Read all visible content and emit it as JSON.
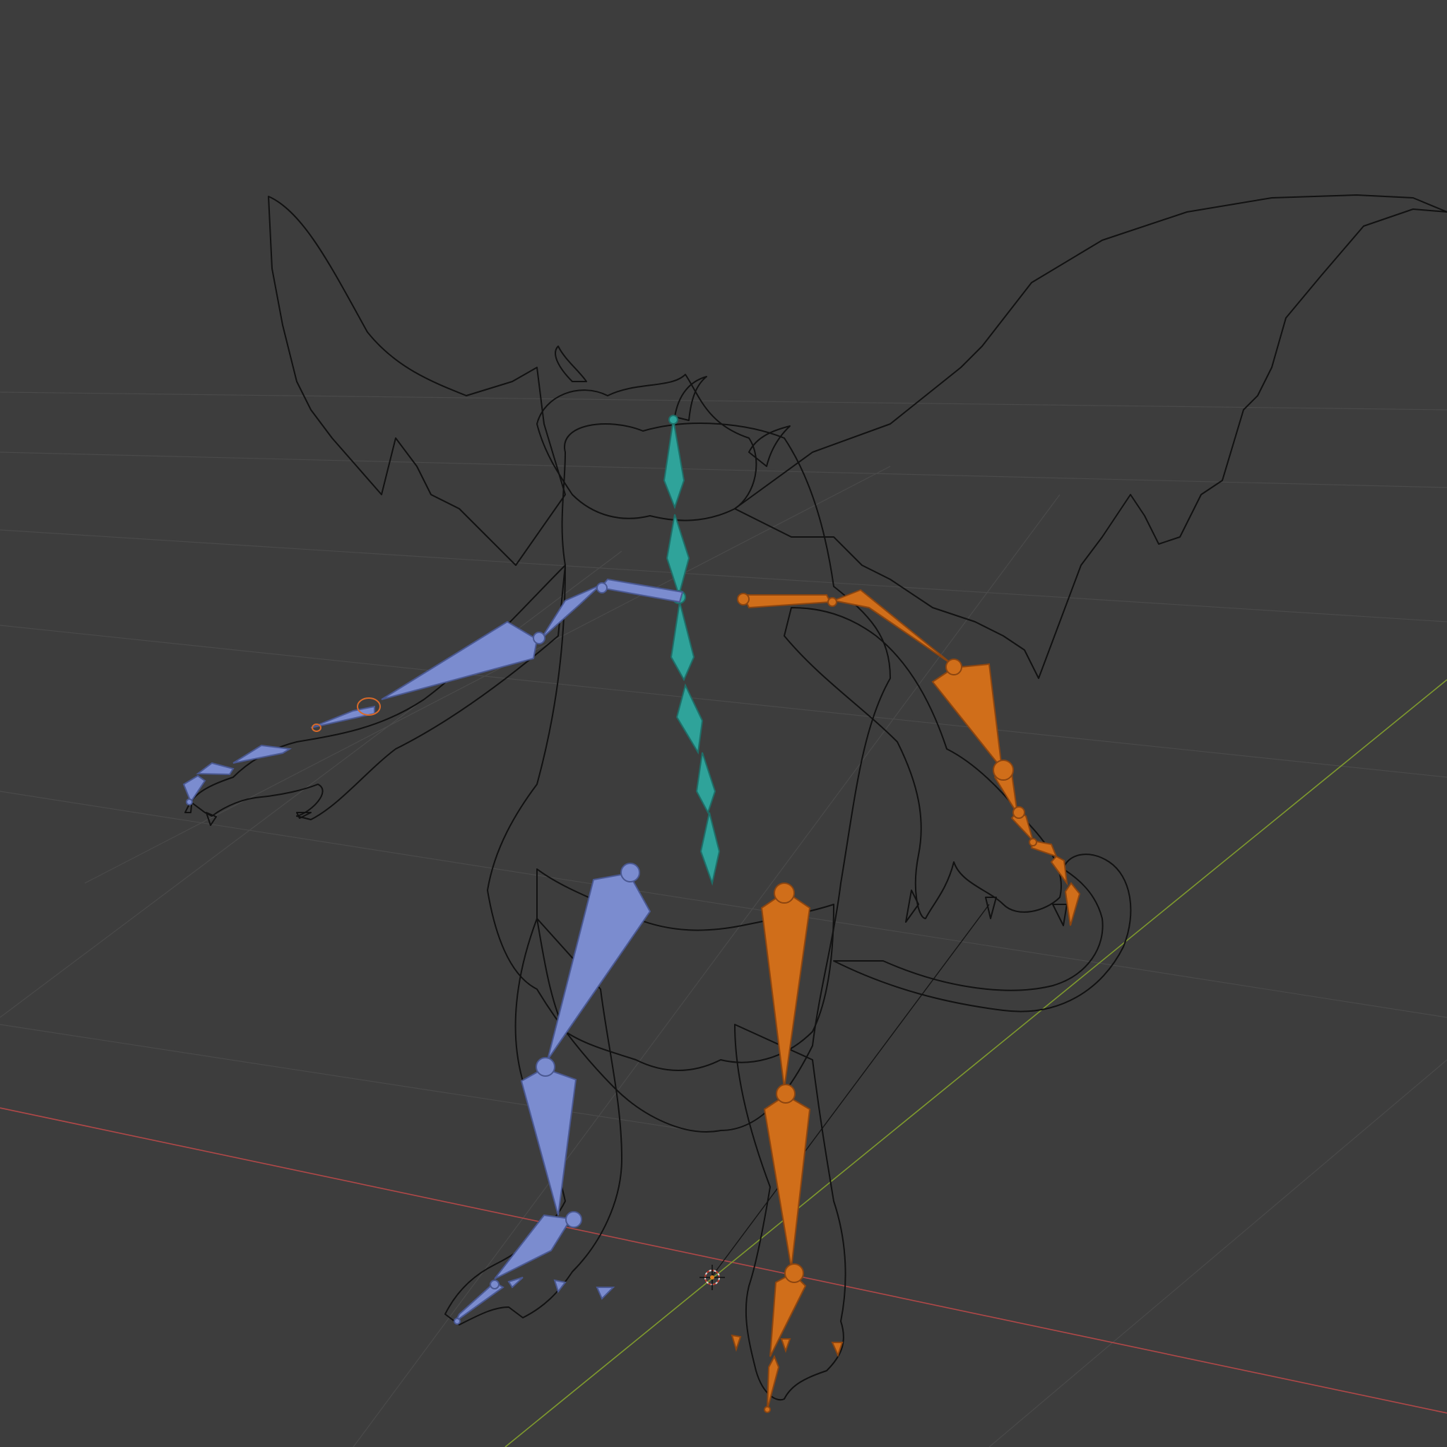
{
  "viewport": {
    "background": "#3d3d3d",
    "grid_color": "#4a4a4a",
    "x_axis_color": "#b04848",
    "y_axis_color": "#7f9a2e",
    "wireframe_color": "#111111"
  },
  "armature": {
    "groups": [
      {
        "name": "spine",
        "color": "#2fa39a"
      },
      {
        "name": "left-limbs",
        "color": "#7b8ccf"
      },
      {
        "name": "right-limbs",
        "color": "#d06e1a"
      }
    ]
  },
  "object": {
    "type": "wireframe-mesh",
    "icon": "dragon-wireframe"
  }
}
